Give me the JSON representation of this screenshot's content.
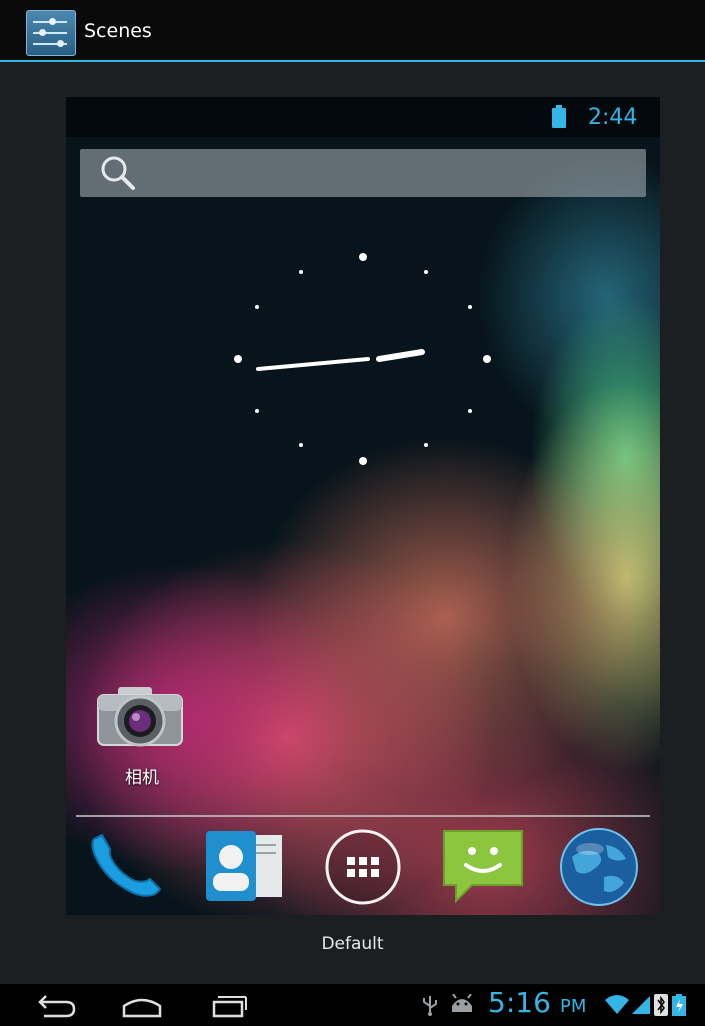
{
  "action_bar": {
    "title": "Scenes",
    "icon": "scenes-sliders-icon",
    "accent_color": "#33b5e5"
  },
  "preview": {
    "status_time": "2:44",
    "status_icons": [
      "battery-icon"
    ],
    "search_icon": "search-icon",
    "clock_widget": "analog-clock-icon",
    "desktop_app": {
      "label": "相机",
      "icon": "camera-icon"
    },
    "dock": [
      {
        "icon": "phone-icon"
      },
      {
        "icon": "contacts-icon"
      },
      {
        "icon": "app-drawer-icon"
      },
      {
        "icon": "messaging-icon"
      },
      {
        "icon": "browser-globe-icon"
      }
    ],
    "caption": "Default"
  },
  "system_bar": {
    "nav": [
      "back-icon",
      "home-icon",
      "recent-apps-icon"
    ],
    "time": "5:16",
    "ampm": "PM",
    "status_icons": [
      "usb-icon",
      "android-debug-icon",
      "wifi-icon",
      "signal-icon",
      "bluetooth-icon",
      "battery-icon"
    ]
  }
}
